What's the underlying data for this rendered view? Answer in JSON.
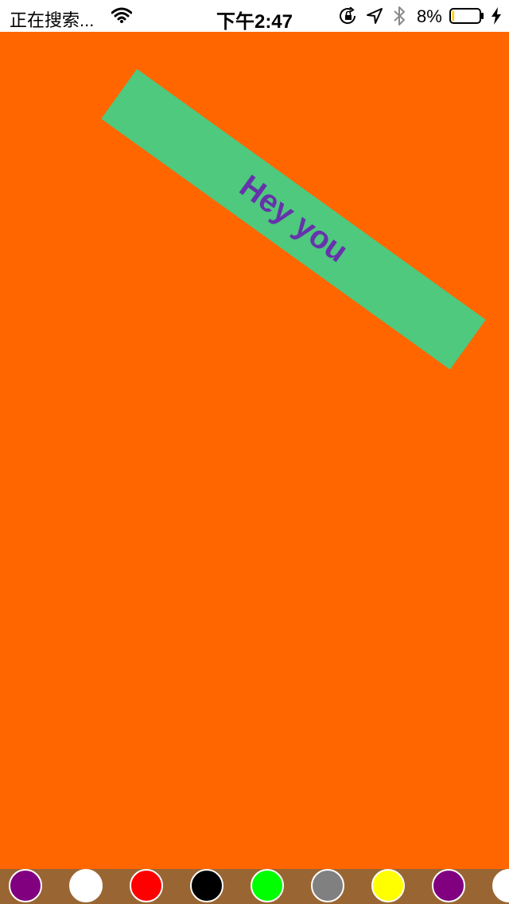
{
  "status_bar": {
    "carrier_text": "正在搜索...",
    "time": "下午2:47",
    "battery_percent": "8%",
    "battery_level": 0.08,
    "battery_fill_color": "#ffcc00",
    "icons": [
      "wifi-icon",
      "orientation-lock-icon",
      "location-icon",
      "bluetooth-icon",
      "battery-icon",
      "charging-icon"
    ]
  },
  "canvas": {
    "background_color": "#ff6600",
    "banner": {
      "text": "Hey you",
      "background_color": "#4ec97e",
      "text_color": "#6633aa"
    }
  },
  "palette": {
    "background_color": "#996633",
    "colors": [
      {
        "name": "purple",
        "hex": "#800080"
      },
      {
        "name": "white",
        "hex": "#ffffff"
      },
      {
        "name": "red",
        "hex": "#ff0000"
      },
      {
        "name": "black",
        "hex": "#000000"
      },
      {
        "name": "green",
        "hex": "#00ff00"
      },
      {
        "name": "gray",
        "hex": "#808080"
      },
      {
        "name": "yellow",
        "hex": "#ffff00"
      },
      {
        "name": "purple",
        "hex": "#800080"
      },
      {
        "name": "white",
        "hex": "#ffffff"
      }
    ]
  }
}
